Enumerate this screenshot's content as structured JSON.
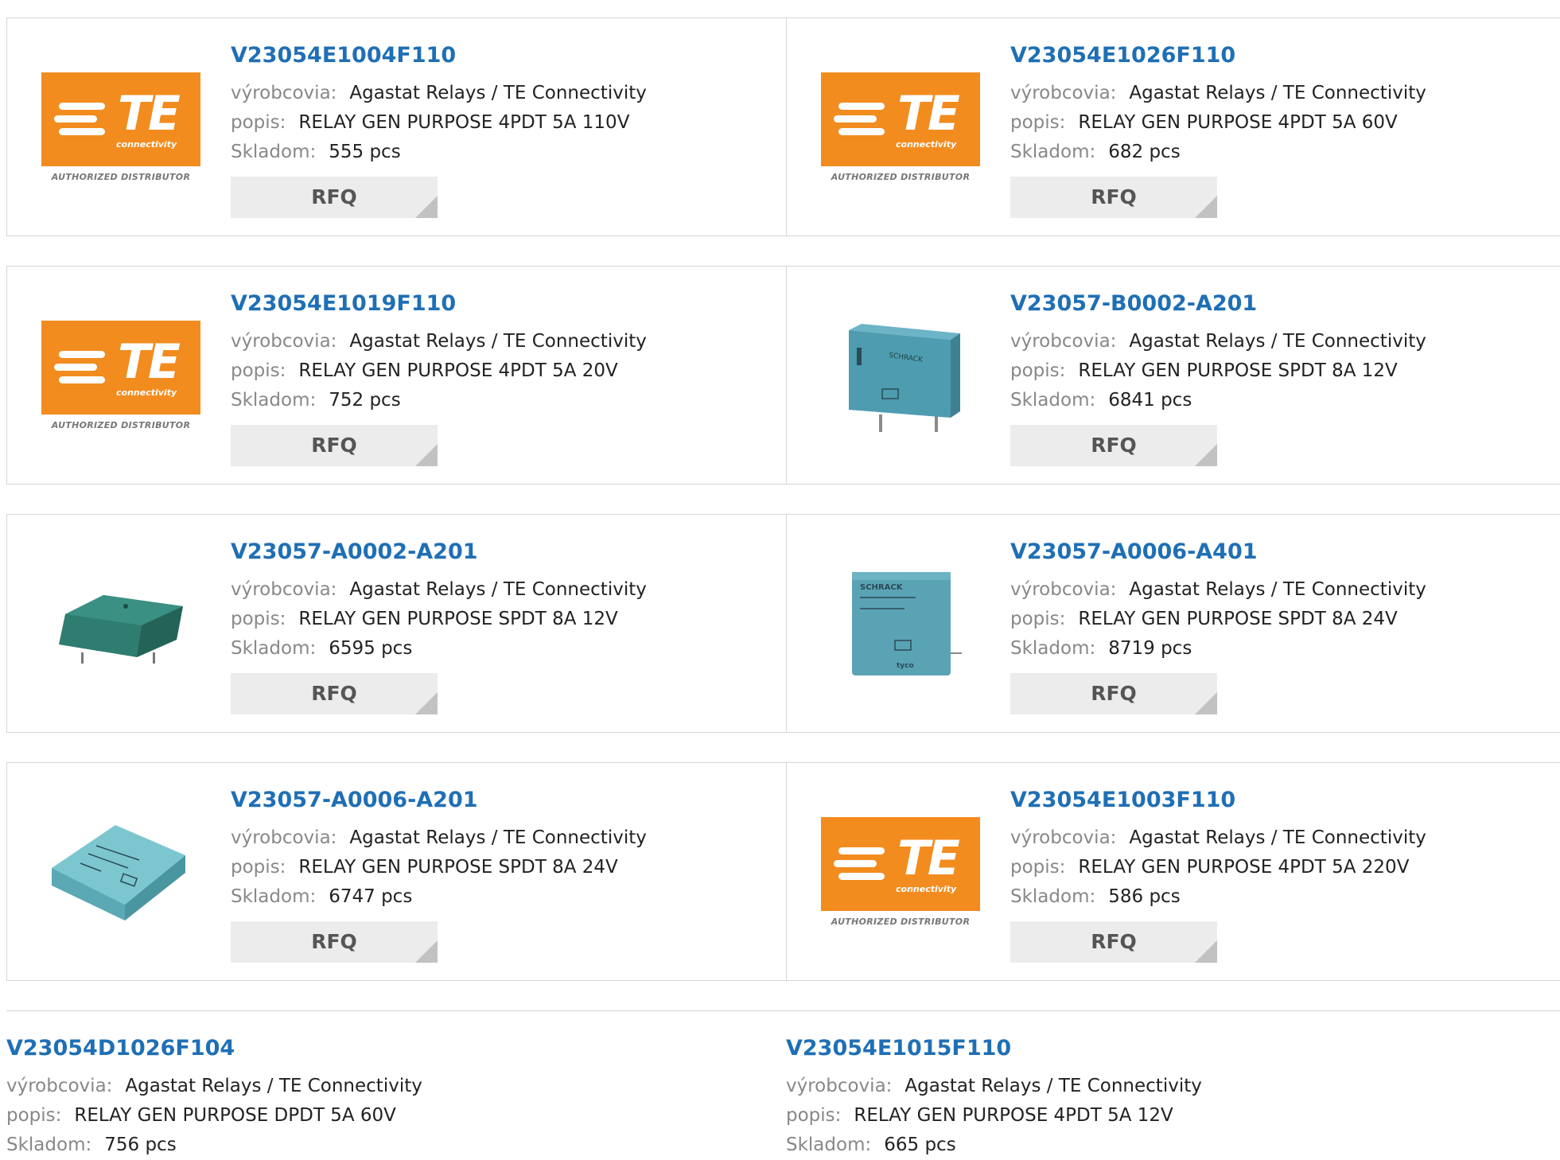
{
  "labels": {
    "manufacturer": "výrobcovia:",
    "description": "popis:",
    "stock": "Skladom:",
    "rfq": "RFQ"
  },
  "logo": {
    "brand": "TE",
    "tagline": "connectivity",
    "authorized": "AUTHORIZED DISTRIBUTOR",
    "color": "#f28c1f"
  },
  "colors": {
    "link": "#1f6fb5",
    "label": "#888888",
    "button_bg": "#ececec"
  },
  "products": [
    {
      "name": "V23054E1004F110",
      "manufacturer": "Agastat Relays / TE Connectivity",
      "description": "RELAY GEN PURPOSE 4PDT 5A 110V",
      "stock": "555 pcs",
      "image": "te-logo"
    },
    {
      "name": "V23054E1026F110",
      "manufacturer": "Agastat Relays / TE Connectivity",
      "description": "RELAY GEN PURPOSE 4PDT 5A 60V",
      "stock": "682 pcs",
      "image": "te-logo"
    },
    {
      "name": "V23054E1019F110",
      "manufacturer": "Agastat Relays / TE Connectivity",
      "description": "RELAY GEN PURPOSE 4PDT 5A 20V",
      "stock": "752 pcs",
      "image": "te-logo"
    },
    {
      "name": "V23057-B0002-A201",
      "manufacturer": "Agastat Relays / TE Connectivity",
      "description": "RELAY GEN PURPOSE SPDT 8A 12V",
      "stock": "6841 pcs",
      "image": "relay-upright-photo"
    },
    {
      "name": "V23057-A0002-A201",
      "manufacturer": "Agastat Relays / TE Connectivity",
      "description": "RELAY GEN PURPOSE SPDT 8A 12V",
      "stock": "6595 pcs",
      "image": "relay-flat-dark-photo"
    },
    {
      "name": "V23057-A0006-A401",
      "manufacturer": "Agastat Relays / TE Connectivity",
      "description": "RELAY GEN PURPOSE SPDT 8A 24V",
      "stock": "8719 pcs",
      "image": "relay-front-photo"
    },
    {
      "name": "V23057-A0006-A201",
      "manufacturer": "Agastat Relays / TE Connectivity",
      "description": "RELAY GEN PURPOSE SPDT 8A 24V",
      "stock": "6747 pcs",
      "image": "relay-flat-light-photo"
    },
    {
      "name": "V23054E1003F110",
      "manufacturer": "Agastat Relays / TE Connectivity",
      "description": "RELAY GEN PURPOSE 4PDT 5A 220V",
      "stock": "586 pcs",
      "image": "te-logo"
    },
    {
      "name": "V23054D1026F104",
      "manufacturer": "Agastat Relays / TE Connectivity",
      "description": "RELAY GEN PURPOSE DPDT 5A 60V",
      "stock": "756 pcs",
      "image": ""
    },
    {
      "name": "V23054E1015F110",
      "manufacturer": "Agastat Relays / TE Connectivity",
      "description": "RELAY GEN PURPOSE 4PDT 5A 12V",
      "stock": "665 pcs",
      "image": ""
    }
  ]
}
